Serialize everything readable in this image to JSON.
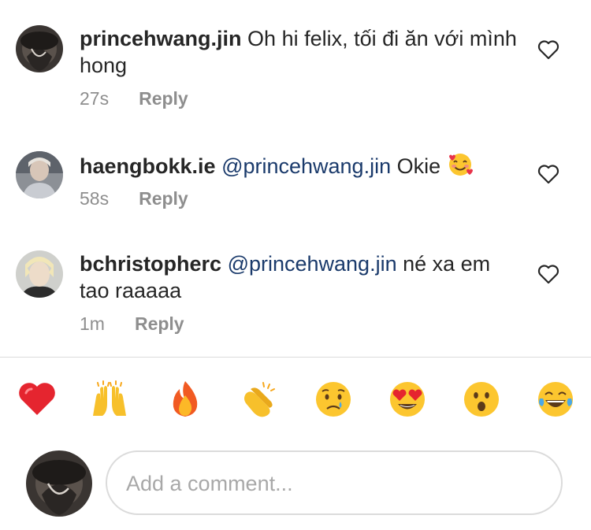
{
  "comments": [
    {
      "username": "princehwang.jin",
      "text": "Oh hi felix, tối đi ăn với mình hong",
      "time": "27s",
      "reply_label": "Reply",
      "avatar_icon": "dark-hat-avatar"
    },
    {
      "username": "haengbokk.ie",
      "mention": "@princehwang.jin",
      "text": "Okie",
      "emoji": "smiling-face-with-hearts",
      "time": "58s",
      "reply_label": "Reply",
      "avatar_icon": "light-hair-avatar"
    },
    {
      "username": "bchristopherc",
      "mention": "@princehwang.jin",
      "text": "né xa em tao raaaaa",
      "time": "1m",
      "reply_label": "Reply",
      "avatar_icon": "blond-hair-avatar"
    }
  ],
  "reactions": [
    {
      "name": "red-heart"
    },
    {
      "name": "raising-hands"
    },
    {
      "name": "fire"
    },
    {
      "name": "clapping-hands"
    },
    {
      "name": "crying-face"
    },
    {
      "name": "heart-eyes"
    },
    {
      "name": "hushed-face"
    },
    {
      "name": "tears-of-joy"
    }
  ],
  "composer": {
    "placeholder": "Add a comment..."
  },
  "colors": {
    "username": "#262626",
    "mention": "#1a3a6b",
    "meta": "#8e8e8e",
    "divider": "#dbdbdb",
    "placeholder": "#a8a8a8"
  }
}
